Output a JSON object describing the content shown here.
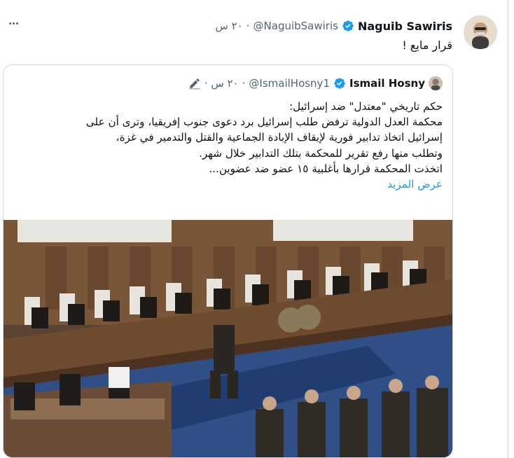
{
  "tweet": {
    "author_name": "Naguib Sawiris",
    "handle": "@NaguibSawiris",
    "time": "٢٠ س",
    "separator": "·",
    "text": "قرار مايع !",
    "more_icon": "more-horizontal-icon",
    "verified_icon": "verified-badge-icon"
  },
  "quote": {
    "author_name": "Ismail Hosny",
    "handle": "@IsmailHosny1",
    "time": "٢٠ س",
    "separator": "·",
    "lines": [
      "حكم تاريخي \"معتدل\" ضد إسرائيل:",
      "محكمة العدل الدولية ترفض طلب إسرائيل برد دعوى جنوب إفريقيا، وترى أن على",
      "إسرائيل اتخاذ تدابير فورية لإيقاف الإبادة الجماعية والقتل والتدمير في غزة،",
      "وتطلب منها رفع تقرير للمحكمة بتلك التدابير خلال شهر.",
      "اتخذت المحكمة قرارها بأغلبية ١٥ عضو ضد عضوين..."
    ],
    "show_more": "عرض المزيد",
    "edit_icon": "pencil-icon",
    "image_desc_name": "courtroom-photo"
  },
  "colors": {
    "link": "#1d9bf0",
    "secondary_text": "#536471",
    "border": "#cfd9de"
  }
}
